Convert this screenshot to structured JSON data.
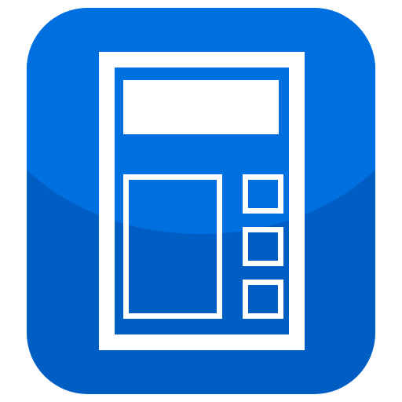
{
  "icon": {
    "name": "calculator-icon",
    "colors": {
      "tile_top": "#0070E0",
      "tile_bottom": "#005DC4",
      "glyph": "#FFFFFF",
      "page_background": "#FFFFFF"
    }
  }
}
